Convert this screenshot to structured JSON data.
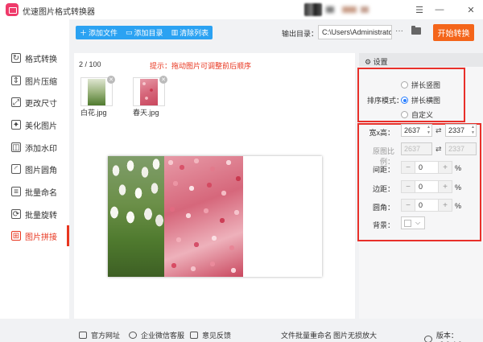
{
  "app": {
    "title": "优速图片格式转换器"
  },
  "window_controls": {
    "minimize": "—",
    "maximize": "☐",
    "close": "✕",
    "menu": "☰"
  },
  "sidebar": {
    "items": [
      {
        "label": "格式转换",
        "icon": "convert-icon",
        "glyph": "↻"
      },
      {
        "label": "图片压缩",
        "icon": "compress-icon",
        "glyph": "⇕"
      },
      {
        "label": "更改尺寸",
        "icon": "resize-icon",
        "glyph": "⤢"
      },
      {
        "label": "美化图片",
        "icon": "beautify-icon",
        "glyph": "✦"
      },
      {
        "label": "添加水印",
        "icon": "watermark-icon",
        "glyph": "◫"
      },
      {
        "label": "图片圆角",
        "icon": "round-corner-icon",
        "glyph": "◜"
      },
      {
        "label": "批量命名",
        "icon": "rename-icon",
        "glyph": "≡"
      },
      {
        "label": "批量旋转",
        "icon": "rotate-icon",
        "glyph": "⟳"
      },
      {
        "label": "图片拼接",
        "icon": "stitch-icon",
        "glyph": "⊞"
      }
    ],
    "active_index": 8
  },
  "toolbar": {
    "add_file": "添加文件",
    "add_folder": "添加目录",
    "clear_list": "清除列表",
    "output_label": "输出目录：",
    "output_path": "C:\\Users\\Administrato",
    "more": "···",
    "start": "开始转换"
  },
  "main": {
    "count": "2 / 100",
    "hint": "提示：拖动图片可调整前后顺序",
    "files": [
      {
        "name": "白花.jpg"
      },
      {
        "name": "春天.jpg"
      }
    ]
  },
  "settings": {
    "header": "设置",
    "mode_label": "排序模式：",
    "modes": [
      "拼长竖图",
      "拼长横图",
      "自定义"
    ],
    "selected_mode": 1,
    "size_label": "宽x高：",
    "width": "2637",
    "height": "2337",
    "ratio_label": "原图比例：",
    "ratio_w": "2637",
    "ratio_h": "2337",
    "spacing_label": "间距：",
    "spacing": "0",
    "margin_label": "边距：",
    "margin": "0",
    "corner_label": "圆角：",
    "corner": "0",
    "percent": "%",
    "bg_label": "背景：",
    "bg_color": "#ffffff",
    "minus": "−",
    "plus": "+"
  },
  "colors": {
    "accent": "#e8361f",
    "start": "#f4651a",
    "toolbar_blue": "#2ba2f2",
    "highlight": "#e8302a"
  },
  "footer": {
    "website": "官方网址",
    "wechat": "企业微信客服",
    "feedback": "意见反馈",
    "batch_rename": "文件批量重命名",
    "lossless": "图片无损放大",
    "version": "版本：v2.0.4.0"
  }
}
